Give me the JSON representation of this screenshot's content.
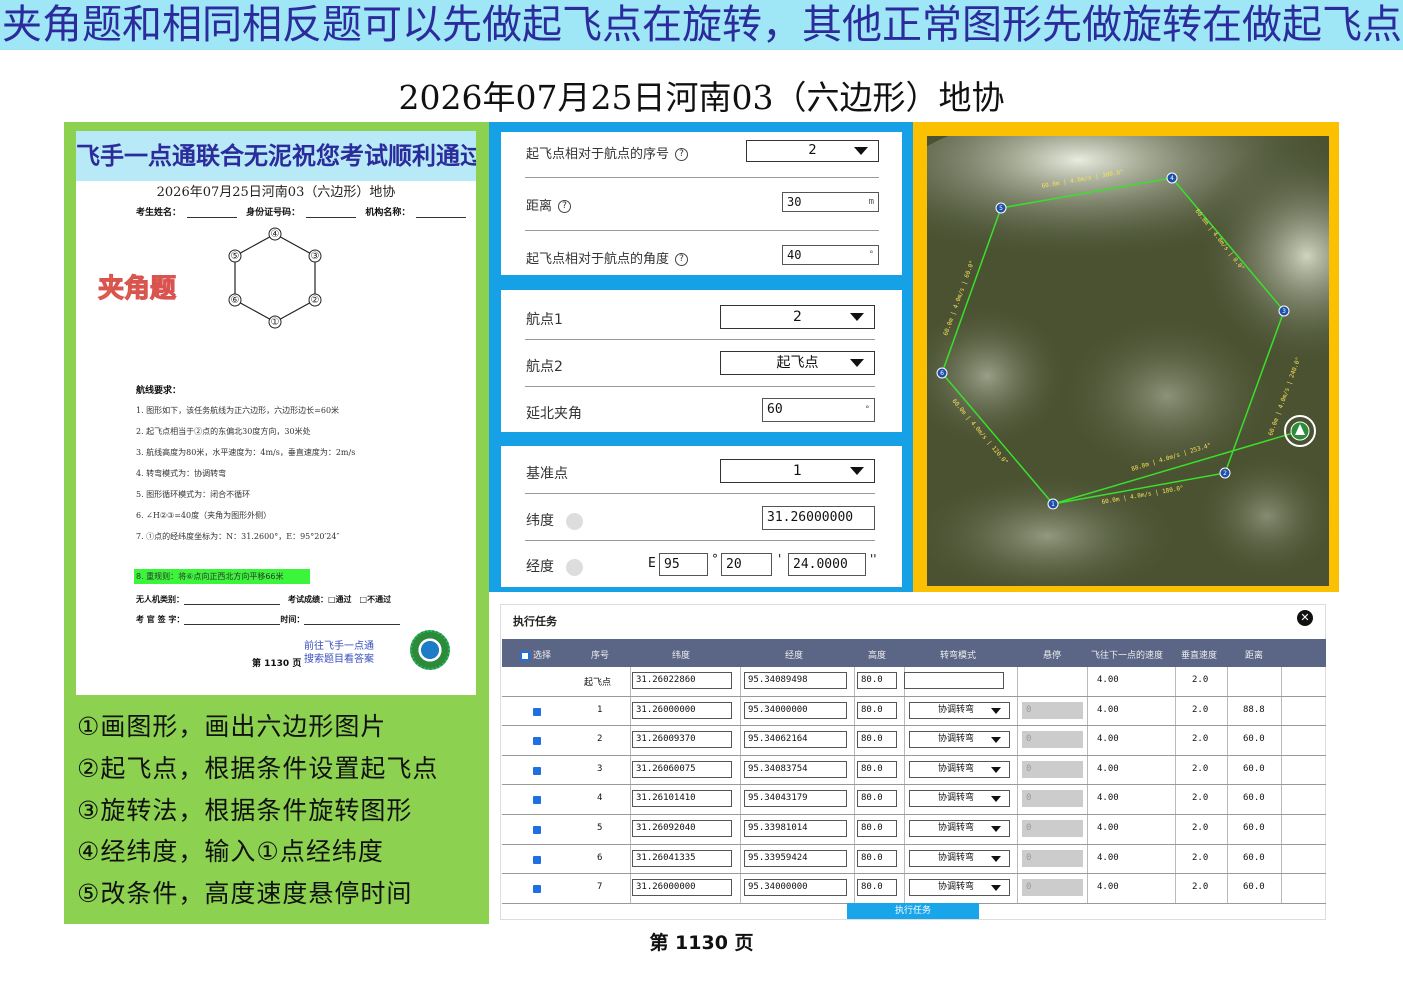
{
  "banner": "夹角题和相同相反题可以先做起飞点在旋转，其他正常图形先做旋转在做起飞点",
  "title": "2026年07月25日河南03（六边形）地协",
  "paper": {
    "banner": "飞手一点通联合无泥祝您考试顺利通过",
    "title": "2026年07月25日河南03（六边形）地协",
    "fields": [
      "考生姓名：",
      "身份证号码：",
      "机构名称："
    ],
    "badge": "夹角题",
    "hex_labels": [
      "④",
      "③",
      "②",
      "①",
      "⑥",
      "⑤"
    ],
    "req_title": "航线要求：",
    "requirements": [
      "1. 图形如下，该任务航线为正六边形，六边形边长=60米",
      "2. 起飞点相当于②点的东偏北30度方向，30米处",
      "3. 航线高度为80米，水平速度为：4m/s，垂直速度为：2m/s",
      "4. 转弯模式为：协调转弯",
      "5. 图形循环模式为：闭合不循环",
      "6. ∠H②③=40度（夹角为图形外侧）",
      "7. ①点的经纬度坐标为：N：31.2600°，E：95°20′24″"
    ],
    "req8": "8. 重规则：将⑥点向正西北方向平移66米",
    "uav_label": "无人机类别：",
    "result_label": "考试成绩：□通过　□不通过",
    "sign_label": "考 官 签 字：",
    "time_label": "时间：",
    "goto": "前往飞手一点通",
    "goto2": "搜索题目看答案",
    "page": "第 1130 页"
  },
  "steps": [
    "①画图形，画出六边形图片",
    "②起飞点，根据条件设置起飞点",
    "③旋转法，根据条件旋转图形",
    "④经纬度，输入①点经纬度",
    "⑤改条件，高度速度悬停时间"
  ],
  "card1": {
    "row1_label": "起飞点相对于航点的序号",
    "row1_value": "2",
    "row2_label": "距离",
    "row2_value": "30",
    "row2_unit": "m",
    "row3_label": "起飞点相对于航点的角度",
    "row3_value": "40",
    "row3_unit": "°"
  },
  "card2": {
    "row1_label": "航点1",
    "row1_value": "2",
    "row2_label": "航点2",
    "row2_value": "起飞点",
    "row3_label": "延北夹角",
    "row3_value": "60",
    "row3_unit": "°"
  },
  "card3": {
    "row1_label": "基准点",
    "row1_value": "1",
    "row2_label": "纬度",
    "row2_value": "31.26000000",
    "row3_label": "经度",
    "lon_prefix": "E",
    "lon_deg": "95",
    "lon_min": "20",
    "lon_sec": "24.0000",
    "deg_sym": "°",
    "min_sym": "'",
    "sec_sym": "''"
  },
  "map": {
    "edge_labels": [
      "60.0m | 4.0m/s | 300.0°",
      "60.0m | 4.0m/s | 0.0°",
      "60.0m | 4.0m/s | 240.0°",
      "60.0m | 4.0m/s | 180.0°",
      "60.0m | 4.0m/s | 120.0°",
      "88.8m | 4.0m/s | 253.4°",
      "60.0m | 4.0m/s | 60.0°"
    ],
    "points": [
      "1",
      "2",
      "3",
      "4",
      "5",
      "6"
    ]
  },
  "task": {
    "title": "执行任务",
    "close": "✕",
    "columns": [
      "选择",
      "序号",
      "纬度",
      "经度",
      "高度",
      "转弯模式",
      "悬停",
      "飞往下一点的速度",
      "垂直速度",
      "距离"
    ],
    "rows": [
      {
        "seq": "起飞点",
        "lat": "31.26022860",
        "lon": "95.34089498",
        "alt": "80.0",
        "turn": "",
        "hover": "",
        "speed": "4.00",
        "vspeed": "2.0",
        "dist": ""
      },
      {
        "seq": "1",
        "lat": "31.26000000",
        "lon": "95.34000000",
        "alt": "80.0",
        "turn": "协调转弯",
        "hover": "0",
        "speed": "4.00",
        "vspeed": "2.0",
        "dist": "88.8"
      },
      {
        "seq": "2",
        "lat": "31.26009370",
        "lon": "95.34062164",
        "alt": "80.0",
        "turn": "协调转弯",
        "hover": "0",
        "speed": "4.00",
        "vspeed": "2.0",
        "dist": "60.0"
      },
      {
        "seq": "3",
        "lat": "31.26060075",
        "lon": "95.34083754",
        "alt": "80.0",
        "turn": "协调转弯",
        "hover": "0",
        "speed": "4.00",
        "vspeed": "2.0",
        "dist": "60.0"
      },
      {
        "seq": "4",
        "lat": "31.26101410",
        "lon": "95.34043179",
        "alt": "80.0",
        "turn": "协调转弯",
        "hover": "0",
        "speed": "4.00",
        "vspeed": "2.0",
        "dist": "60.0"
      },
      {
        "seq": "5",
        "lat": "31.26092040",
        "lon": "95.33981014",
        "alt": "80.0",
        "turn": "协调转弯",
        "hover": "0",
        "speed": "4.00",
        "vspeed": "2.0",
        "dist": "60.0"
      },
      {
        "seq": "6",
        "lat": "31.26041335",
        "lon": "95.33959424",
        "alt": "80.0",
        "turn": "协调转弯",
        "hover": "0",
        "speed": "4.00",
        "vspeed": "2.0",
        "dist": "60.0"
      },
      {
        "seq": "7",
        "lat": "31.26000000",
        "lon": "95.34000000",
        "alt": "80.0",
        "turn": "协调转弯",
        "hover": "0",
        "speed": "4.00",
        "vspeed": "2.0",
        "dist": "60.0"
      }
    ],
    "exec_button": "执行任务"
  },
  "footer": "第 1130 页"
}
